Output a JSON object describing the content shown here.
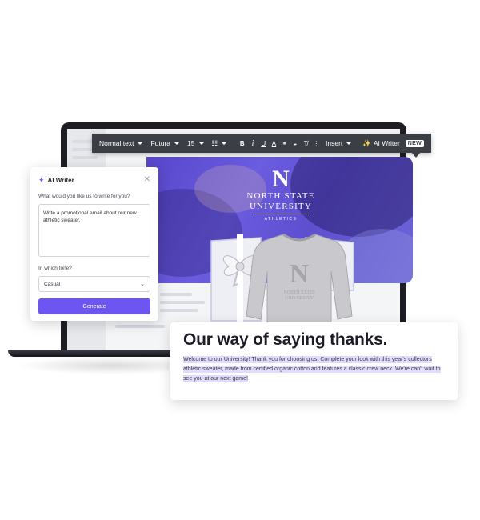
{
  "toolbar": {
    "style_dropdown": "Normal text",
    "font_dropdown": "Futura",
    "size_dropdown": "15",
    "insert_dropdown": "Insert",
    "ai_writer_label": "AI Writer",
    "new_badge": "NEW",
    "icons": [
      "list-icon",
      "bold-icon",
      "italic-icon",
      "underline-icon",
      "text-color-icon",
      "link-icon",
      "highlight-icon",
      "clear-format-icon",
      "more-icon",
      "magic-wand-icon"
    ]
  },
  "hero": {
    "brand_name_line1": "NORTH STATE",
    "brand_name_line2": "UNIVERSITY",
    "brand_sub": "ATHLETICS",
    "sweater_print_line1": "NORTH STATE",
    "sweater_print_line2": "UNIVERSITY"
  },
  "ai_writer": {
    "title": "AI Writer",
    "prompt_label": "What would you like us to write for you?",
    "prompt_value": "Write a promotional email about our new athletic sweater.",
    "tone_label": "In which tone?",
    "tone_value": "Casual",
    "generate_label": "Generate"
  },
  "email_card": {
    "title": "Our way of saying thanks.",
    "body": "Welcome to our University! Thank you for choosing us. Complete your look with this year's collectors athletic sweater, made from certified organic cotton and features a classic crew neck. We're can't wait to see you at our next game!"
  },
  "colors": {
    "accent_purple": "#6d55f2",
    "toolbar_bg": "#3b3e45",
    "hero_purple": "#5746c9",
    "highlight": "#e1dcfa"
  }
}
